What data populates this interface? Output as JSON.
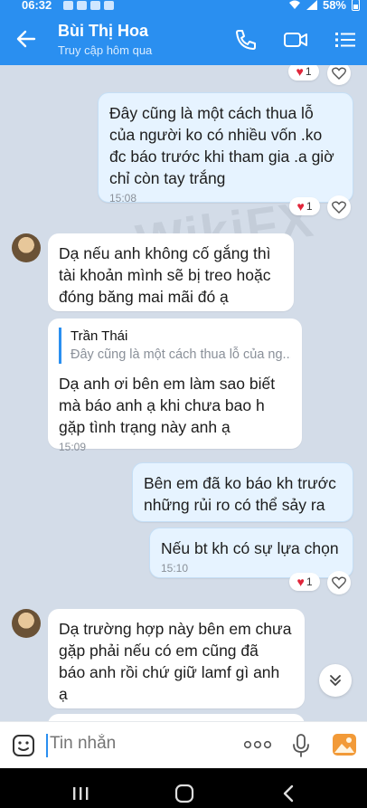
{
  "status": {
    "time": "06:32",
    "battery": "58%"
  },
  "header": {
    "name": "Bùi Thị Hoa",
    "subtitle": "Truy cập hôm qua"
  },
  "watermark": "WikiFX",
  "messages": [
    {
      "id": "m0",
      "side": "out",
      "reaction_count": "1"
    },
    {
      "id": "m1",
      "side": "out",
      "lines": [
        "Đây cũng là một cách thua lỗ",
        "của người ko có nhiều vốn .ko",
        "đc báo trước khi tham gia .a giờ",
        "chỉ còn tay trắng"
      ],
      "time": "15:08",
      "reaction_count": "1"
    },
    {
      "id": "m2",
      "side": "in",
      "lines": [
        "Dạ nếu anh không cố gắng thì",
        "tài khoản mình sẽ bị treo hoặc",
        "đóng băng mai mãi đó ạ"
      ]
    },
    {
      "id": "m3",
      "side": "in",
      "quote_name": "Trần Thái",
      "quote_text": "Đây cũng là một cách thua lỗ của ng...",
      "lines": [
        "Dạ anh ơi bên em làm sao biết",
        "mà báo anh ạ khi chưa bao h",
        "gặp tình trạng này anh ạ"
      ],
      "time": "15:09"
    },
    {
      "id": "m4",
      "side": "out",
      "lines": [
        "Bên em đã ko báo kh trước",
        "những rủi ro có thể sảy ra"
      ]
    },
    {
      "id": "m5",
      "side": "out",
      "lines": [
        "Nếu bt kh có sự lựa chọn"
      ],
      "time": "15:10",
      "reaction_count": "1"
    },
    {
      "id": "m6",
      "side": "in",
      "lines": [
        "Dạ trường hợp này bên em chưa",
        "gặp phải nếu có em cũng đã",
        "báo anh rồi chứ giữ lamf gì anh",
        "ạ"
      ]
    }
  ],
  "input": {
    "placeholder": "Tin nhắn"
  },
  "colors": {
    "brand": "#2a8ff0",
    "outgoing_bubble": "#e6f3ff",
    "incoming_bubble": "#ffffff",
    "chat_bg": "#d3dce8",
    "heart": "#e0263a"
  }
}
